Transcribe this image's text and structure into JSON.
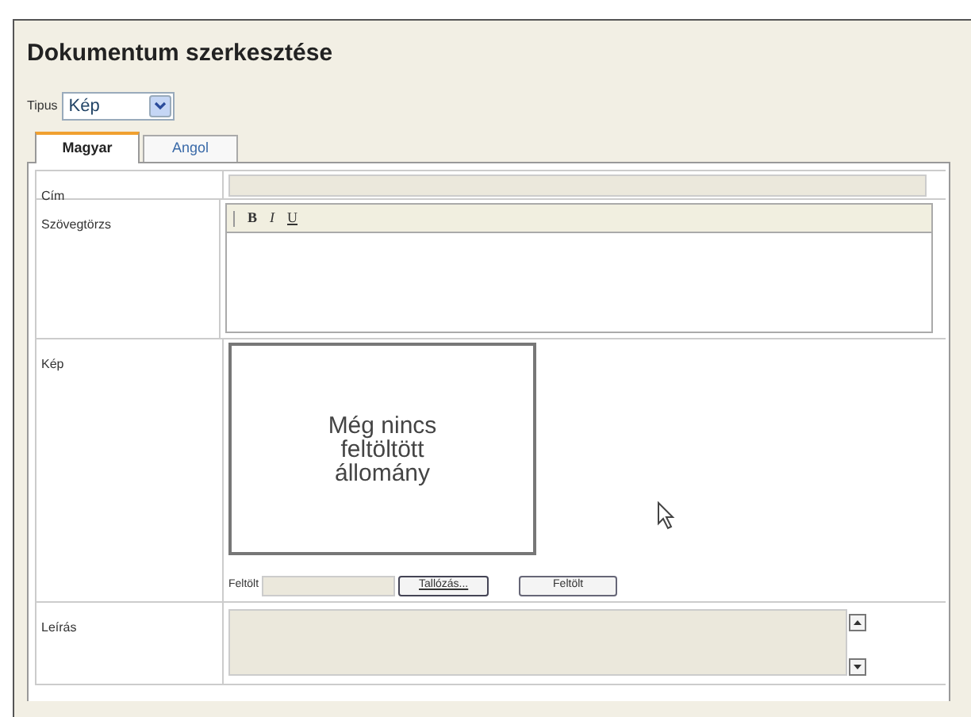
{
  "title": "Dokumentum szerkesztése",
  "type_field": {
    "label": "Tipus",
    "value": "Kép"
  },
  "tabs": [
    {
      "label": "Magyar",
      "selected": true
    },
    {
      "label": "Angol",
      "selected": false
    }
  ],
  "fields": [
    {
      "kind": "text",
      "label": "Cím"
    },
    {
      "kind": "richtext",
      "label": "Szövegtörzs",
      "toolbar": [
        "B",
        "I",
        "U"
      ]
    },
    {
      "kind": "image",
      "label": "Kép",
      "placeholder_text": "Még nincs feltöltött állomány",
      "upload_label": "Feltölt",
      "browse_button": "Tallózás...",
      "upload_button": "Feltölt"
    },
    {
      "kind": "textarea",
      "label": "Leírás"
    }
  ]
}
